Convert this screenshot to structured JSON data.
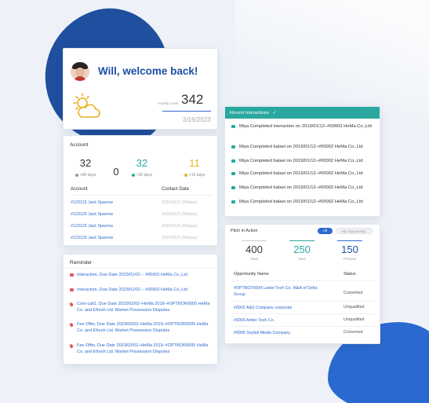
{
  "welcome": {
    "greeting": "Will, welcome back!",
    "activity_label": "Activity Level",
    "activity_value": "342",
    "date": "3/16/2023"
  },
  "account": {
    "title": "Account",
    "stats": [
      {
        "value": "32",
        "label": ">60 days",
        "color": "#999999"
      },
      {
        "value": "0",
        "label": "",
        "color": "#333333"
      },
      {
        "value": "32",
        "label": ">30 days",
        "color": "#2aa8a0"
      },
      {
        "value": "11",
        "label": "<15 days",
        "color": "#e6b422"
      }
    ],
    "columns": [
      "Account",
      "Contact Date"
    ],
    "rows": [
      {
        "account": "#123123 Jack Sparrow",
        "date": "2021/01/2 (30days)"
      },
      {
        "account": "#123123 Jack Sparrow",
        "date": "2021/01/2 (30days)"
      },
      {
        "account": "#123123 Jack Sparrow",
        "date": "2021/01/2 (30days)"
      },
      {
        "account": "#123123 Jack Sparrow",
        "date": "2021/01/2 (30days)"
      }
    ]
  },
  "reminder": {
    "title": "Reminder",
    "items": [
      "Interaction, Due Date 2023/01/02 – #00002 HeMa Co.,Ltd",
      "Interaction, Due Date 2023/01/02 – #00002 HeMa Co.,Ltd",
      "Com-call1, Due Date 2023/02/02–HeMa 2019–#OPTBOR0005 HeMa Co. and Efresh Ltd. Market Possession Disputes",
      "Fee Offer, Due Date 2023/02/02–HeMa 2019–#OPTBOR0005 HeMa Co. and Efresh Ltd. Market Possession Disputes",
      "Fee Offer, Due Date 2023/02/02–HeMa 2019–#OPTBOR0005 HeMa Co. and Efresh Ltd. Market Possession Disputes"
    ]
  },
  "interactions": {
    "title": "Recent Interactions",
    "items": [
      "Miya Completed interaction on 2019/01/12–#00003 HeMa Co.,Ltd",
      "Miya Completed balaei on 2019/01/12–#00002 HeMa Co.,Ltd",
      "Miya Completed balaei on 2019/01/12–#00002 HeMa Co.,Ltd",
      "Miya Completed balaei on 2019/01/12–#00002 HeMa Co.,Ltd",
      "Miya Completed balaei on 2019/01/12–#00002 HeMa Co.,Ltd",
      "Miya Completed balaei on 2019/01/12–#00002 HeMa Co.,Ltd"
    ]
  },
  "pitch": {
    "title": "Pitch in Action",
    "tabs": [
      "All",
      "My Opportunity"
    ],
    "stats": [
      {
        "value": "400",
        "label": "Total",
        "color": "#333333",
        "bar": "#cccccc"
      },
      {
        "value": "250",
        "label": "Deal",
        "color": "#2aa8a0",
        "bar": "#2aa8a0"
      },
      {
        "value": "150",
        "label": "Process",
        "color": "#1e4fa6",
        "bar": "#2d6ad0"
      }
    ],
    "columns": [
      "Opportunity Name",
      "Status"
    ],
    "rows": [
      {
        "name": "#OPTBCF0004 Lastel Tech Co. M&A of Delta Group",
        "status": "Converted"
      },
      {
        "name": "#0002 A&S Company corporate",
        "status": "Unqualified"
      },
      {
        "name": "#0003 Antler Tech Co.",
        "status": "Unqualified"
      },
      {
        "name": "#0005 Seyfali Media Company",
        "status": "Converted"
      }
    ]
  }
}
